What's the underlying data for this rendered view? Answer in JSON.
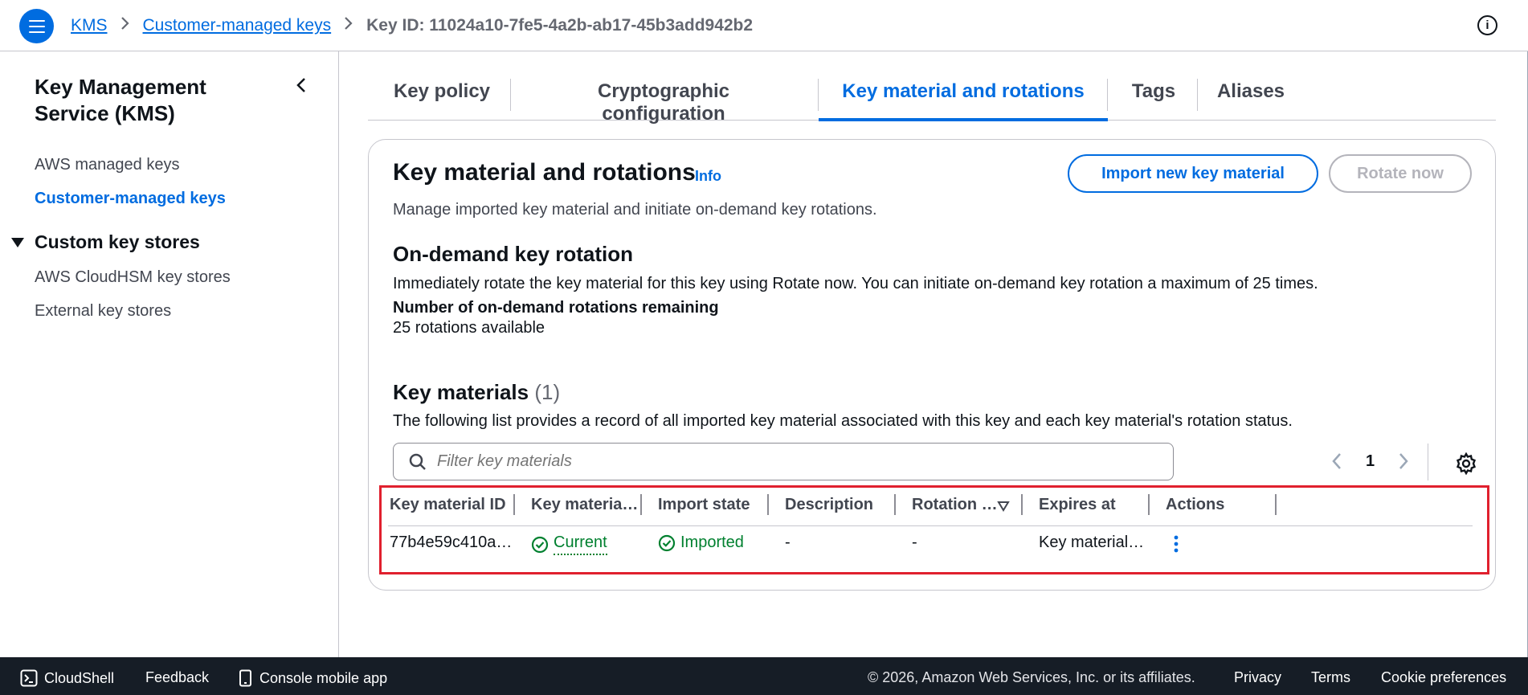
{
  "header": {
    "breadcrumbs": [
      "KMS",
      "Customer-managed keys"
    ],
    "current": "Key ID: 11024a10-7fe5-4a2b-ab17-45b3add942b2"
  },
  "sidebar": {
    "title": "Key Management Service (KMS)",
    "items": [
      {
        "label": "AWS managed keys",
        "active": false
      },
      {
        "label": "Customer-managed keys",
        "active": true
      }
    ],
    "section": {
      "label": "Custom key stores",
      "items": [
        "AWS CloudHSM key stores",
        "External key stores"
      ]
    }
  },
  "tabs": [
    "Key policy",
    "Cryptographic configuration",
    "Key material and rotations",
    "Tags",
    "Aliases"
  ],
  "active_tab": "Key material and rotations",
  "panel": {
    "title": "Key material and rotations",
    "info": "Info",
    "description": "Manage imported key material and initiate on-demand key rotations.",
    "import_button": "Import new key material",
    "rotate_button": "Rotate now",
    "on_demand": {
      "heading": "On-demand key rotation",
      "text": "Immediately rotate the key material for this key using Rotate now. You can initiate on-demand key rotation a maximum of 25 times.",
      "remaining_label": "Number of on-demand rotations remaining",
      "remaining_value": "25 rotations available"
    },
    "materials": {
      "heading": "Key materials",
      "count": "(1)",
      "description": "The following list provides a record of all imported key material associated with this key and each key material's rotation status.",
      "filter_placeholder": "Filter key materials",
      "page": "1",
      "columns": [
        "Key material ID",
        "Key materia…",
        "Import state",
        "Description",
        "Rotation …",
        "Expires at",
        "Actions"
      ],
      "rows": [
        {
          "id": "77b4e59c410a…",
          "status": "Current",
          "import_state": "Imported",
          "description": "-",
          "rotation": "-",
          "expires": "Key material…"
        }
      ]
    }
  },
  "footer": {
    "cloudshell": "CloudShell",
    "feedback": "Feedback",
    "mobile": "Console mobile app",
    "copyright": "© 2026, Amazon Web Services, Inc. or its affiliates.",
    "privacy": "Privacy",
    "terms": "Terms",
    "cookies": "Cookie preferences"
  },
  "colors": {
    "accent": "#006ce0",
    "success": "#00802f",
    "highlight": "#e0202e",
    "footer_bg": "#161d26"
  }
}
